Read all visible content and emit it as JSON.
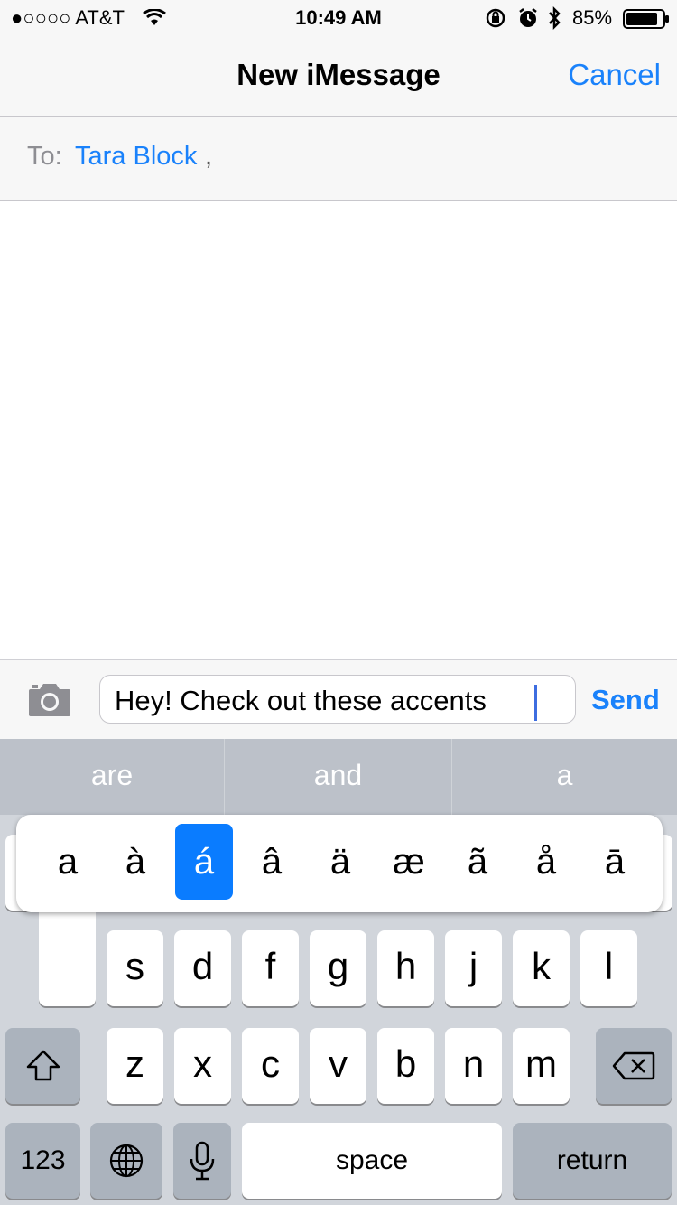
{
  "status_bar": {
    "carrier": "●○○○○ AT&T",
    "time": "10:49 AM",
    "battery": "85%"
  },
  "nav": {
    "title": "New iMessage",
    "cancel": "Cancel"
  },
  "recipient": {
    "label": "To:",
    "name": "Tara Block",
    "separator": ","
  },
  "compose": {
    "text": "Hey! Check out these accents",
    "send": "Send"
  },
  "predictions": [
    "are",
    "and",
    "a"
  ],
  "accent_popup": {
    "options": [
      "a",
      "à",
      "á",
      "â",
      "ä",
      "æ",
      "ã",
      "å",
      "ā"
    ],
    "selected_index": 2
  },
  "keyboard": {
    "row2": [
      "s",
      "d",
      "f",
      "g",
      "h",
      "j",
      "k",
      "l"
    ],
    "row3": [
      "z",
      "x",
      "c",
      "v",
      "b",
      "n",
      "m"
    ],
    "numbers_label": "123",
    "space_label": "space",
    "return_label": "return"
  },
  "colors": {
    "accent": "#1a82fb",
    "selected_accent_bg": "#0a7cff",
    "keyboard_bg": "#d1d5db"
  }
}
